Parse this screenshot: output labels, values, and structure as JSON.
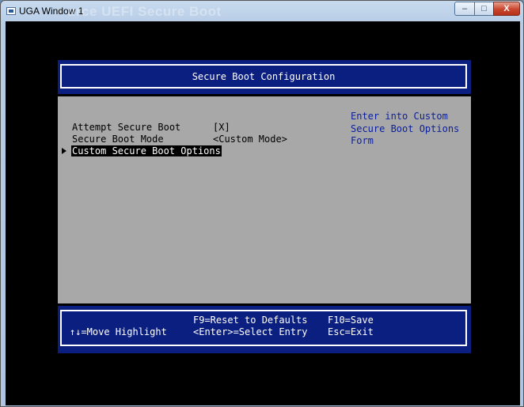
{
  "window": {
    "title": "UGA Window 1",
    "ghost_title": "urce UEFI Secure Boot",
    "minimize_glyph": "–",
    "maximize_glyph": "□",
    "close_glyph": "X"
  },
  "header": {
    "title": "Secure Boot Configuration"
  },
  "form": {
    "items": [
      {
        "label": "Attempt Secure Boot",
        "value": "[X]"
      },
      {
        "label": "Secure Boot Mode",
        "value": "<Custom Mode>"
      },
      {
        "label": "Custom Secure Boot Options",
        "value": ""
      }
    ],
    "help": "Enter into Custom\nSecure Boot Options\nForm"
  },
  "footer": {
    "move": "↑↓=Move Highlight",
    "reset": "F9=Reset to Defaults",
    "select": "<Enter>=Select Entry",
    "save": "F10=Save",
    "exit": "Esc=Exit"
  },
  "colors": {
    "panel_blue": "#0b1f80",
    "panel_gray": "#a8a8a8",
    "help_text": "#0b1f9a"
  }
}
